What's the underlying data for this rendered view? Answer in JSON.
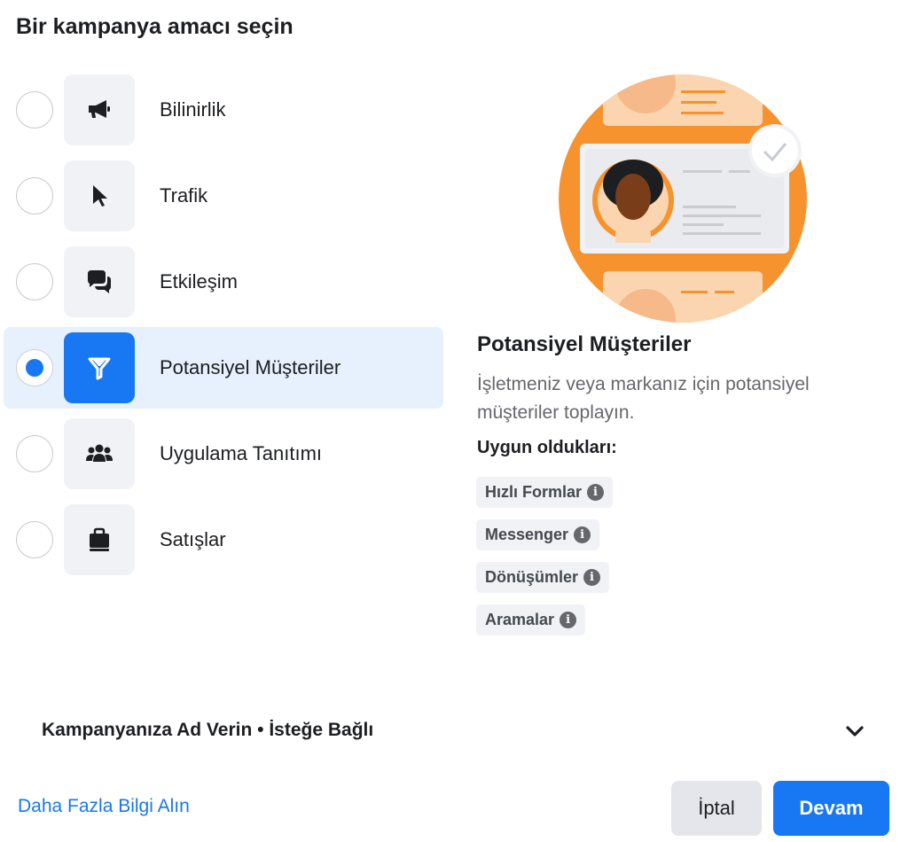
{
  "heading": "Bir kampanya amacı seçin",
  "objectives": [
    {
      "label": "Bilinirlik",
      "icon": "megaphone-icon",
      "selected": false
    },
    {
      "label": "Trafik",
      "icon": "cursor-icon",
      "selected": false
    },
    {
      "label": "Etkileşim",
      "icon": "chat-bubbles-icon",
      "selected": false
    },
    {
      "label": "Potansiyel Müşteriler",
      "icon": "funnel-icon",
      "selected": true
    },
    {
      "label": "Uygulama Tanıtımı",
      "icon": "people-icon",
      "selected": false
    },
    {
      "label": "Satışlar",
      "icon": "shopping-bag-icon",
      "selected": false
    }
  ],
  "details": {
    "title": "Potansiyel Müşteriler",
    "description": "İşletmeniz veya markanız için potansiyel müşteriler toplayın.",
    "suitable_label": "Uygun oldukları:",
    "chips": [
      "Hızlı Formlar",
      "Messenger",
      "Dönüşümler",
      "Aramalar"
    ]
  },
  "campaign_name_row": "Kampanyanıza Ad Verin • İsteğe Bağlı",
  "learn_more": "Daha Fazla Bilgi Alın",
  "buttons": {
    "cancel": "İptal",
    "continue": "Devam"
  },
  "colors": {
    "accent": "#1877f2",
    "selected_bg": "#e7f0fd",
    "illustration_orange": "#f7932e"
  }
}
